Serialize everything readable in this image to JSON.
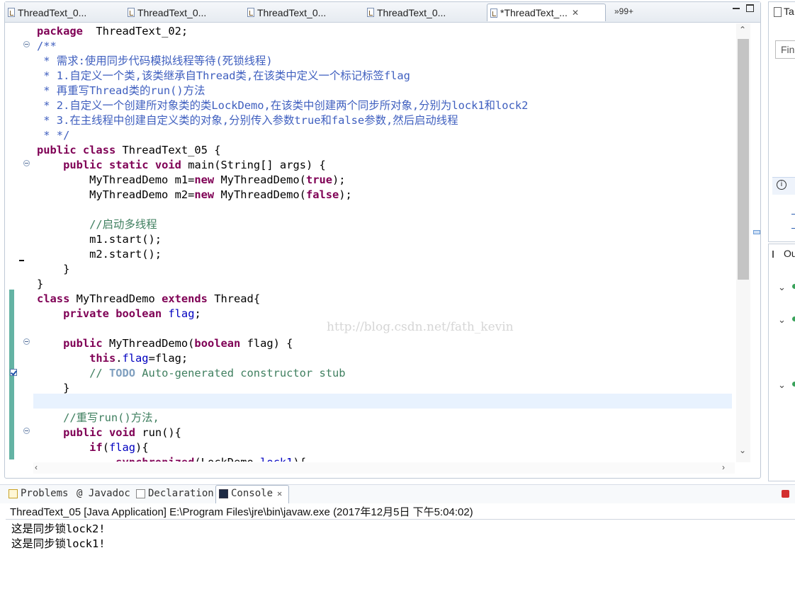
{
  "editor": {
    "tabs": [
      {
        "label": "ThreadText_0...",
        "active": false
      },
      {
        "label": "ThreadText_0...",
        "active": false
      },
      {
        "label": "ThreadText_0...",
        "active": false
      },
      {
        "label": "ThreadText_0...",
        "active": false
      },
      {
        "label": "*ThreadText_...",
        "active": true
      }
    ],
    "close_glyph": "✕",
    "overflow_label": "»99+",
    "watermark": "http://blog.csdn.net/fath_kevin",
    "code_lines": [
      [
        [
          "kw",
          "package"
        ],
        [
          "",
          "  ThreadText_02;"
        ]
      ],
      [
        [
          "jd",
          "/**"
        ]
      ],
      [
        [
          "jd",
          " * 需求:使用同步代码模拟线程等待(死锁线程)"
        ]
      ],
      [
        [
          "jd",
          " * 1.自定义一个类,该类继承自Thread类,在该类中定义一个标记标签flag"
        ]
      ],
      [
        [
          "jd",
          " * 再重写Thread类的run()方法"
        ]
      ],
      [
        [
          "jd",
          " * 2.自定义一个创建所对象类的类LockDemo,在该类中创建两个同步所对象,分别为lock1和lock2"
        ]
      ],
      [
        [
          "jd",
          " * 3.在主线程中创建自定义类的对象,分别传入参数true和false参数,然后启动线程"
        ]
      ],
      [
        [
          "jd",
          " * */"
        ]
      ],
      [
        [
          "kw",
          "public"
        ],
        [
          "",
          " "
        ],
        [
          "kw",
          "class"
        ],
        [
          "",
          " ThreadText_05 {"
        ]
      ],
      [
        [
          "",
          "    "
        ],
        [
          "kw",
          "public"
        ],
        [
          "",
          " "
        ],
        [
          "kw",
          "static"
        ],
        [
          "",
          " "
        ],
        [
          "kw",
          "void"
        ],
        [
          "",
          " main(String[] args) {"
        ]
      ],
      [
        [
          "",
          "        MyThreadDemo m1="
        ],
        [
          "kw",
          "new"
        ],
        [
          "",
          " MyThreadDemo("
        ],
        [
          "kw",
          "true"
        ],
        [
          "",
          ");"
        ]
      ],
      [
        [
          "",
          "        MyThreadDemo m2="
        ],
        [
          "kw",
          "new"
        ],
        [
          "",
          " MyThreadDemo("
        ],
        [
          "kw",
          "false"
        ],
        [
          "",
          ");"
        ]
      ],
      [
        [
          "",
          ""
        ]
      ],
      [
        [
          "cm",
          "        //启动多线程"
        ]
      ],
      [
        [
          "",
          "        m1.start();"
        ]
      ],
      [
        [
          "",
          "        m2.start();"
        ]
      ],
      [
        [
          "",
          "    }"
        ]
      ],
      [
        [
          "",
          "}"
        ]
      ],
      [
        [
          "kw",
          "class"
        ],
        [
          "",
          " MyThreadDemo "
        ],
        [
          "kw",
          "extends"
        ],
        [
          "",
          " Thread{"
        ]
      ],
      [
        [
          "",
          "    "
        ],
        [
          "kw",
          "private"
        ],
        [
          "",
          " "
        ],
        [
          "kw",
          "boolean"
        ],
        [
          "",
          " "
        ],
        [
          "fld",
          "flag"
        ],
        [
          "",
          ";"
        ]
      ],
      [
        [
          "",
          ""
        ]
      ],
      [
        [
          "",
          "    "
        ],
        [
          "kw",
          "public"
        ],
        [
          "",
          " MyThreadDemo("
        ],
        [
          "kw",
          "boolean"
        ],
        [
          "",
          " flag) {"
        ]
      ],
      [
        [
          "",
          "        "
        ],
        [
          "kw",
          "this"
        ],
        [
          "",
          "."
        ],
        [
          "fld",
          "flag"
        ],
        [
          "",
          "=flag;"
        ]
      ],
      [
        [
          "cm",
          "        // "
        ],
        [
          "jdk",
          "TODO"
        ],
        [
          "cm",
          " Auto-generated constructor stub"
        ]
      ],
      [
        [
          "",
          "    }"
        ]
      ],
      [
        [
          "",
          ""
        ]
      ],
      [
        [
          "cm",
          "    //重写run()方法,"
        ]
      ],
      [
        [
          "",
          "    "
        ],
        [
          "kw",
          "public"
        ],
        [
          "",
          " "
        ],
        [
          "kw",
          "void"
        ],
        [
          "",
          " run(){"
        ]
      ],
      [
        [
          "",
          "        "
        ],
        [
          "kw",
          "if"
        ],
        [
          "",
          "("
        ],
        [
          "fld",
          "flag"
        ],
        [
          "",
          "){"
        ]
      ],
      [
        [
          "",
          "            "
        ],
        [
          "kw",
          "synchronized"
        ],
        [
          "",
          "(LockDemo."
        ],
        [
          "fld",
          "lock1"
        ],
        [
          "",
          "){"
        ]
      ]
    ]
  },
  "right_panels": {
    "top_label": "Ta",
    "find_placeholder": "Fin",
    "bottom_label": "Ou"
  },
  "console": {
    "tabs": [
      {
        "label": "Problems"
      },
      {
        "label": "@ Javadoc"
      },
      {
        "label": "Declaration"
      },
      {
        "label": "Console",
        "active": true
      }
    ],
    "header": "ThreadText_05 [Java Application] E:\\Program Files\\jre\\bin\\javaw.exe (2017年12月5日 下午5:04:02)",
    "output": [
      "这是同步锁lock2!",
      "这是同步锁lock1!"
    ]
  }
}
